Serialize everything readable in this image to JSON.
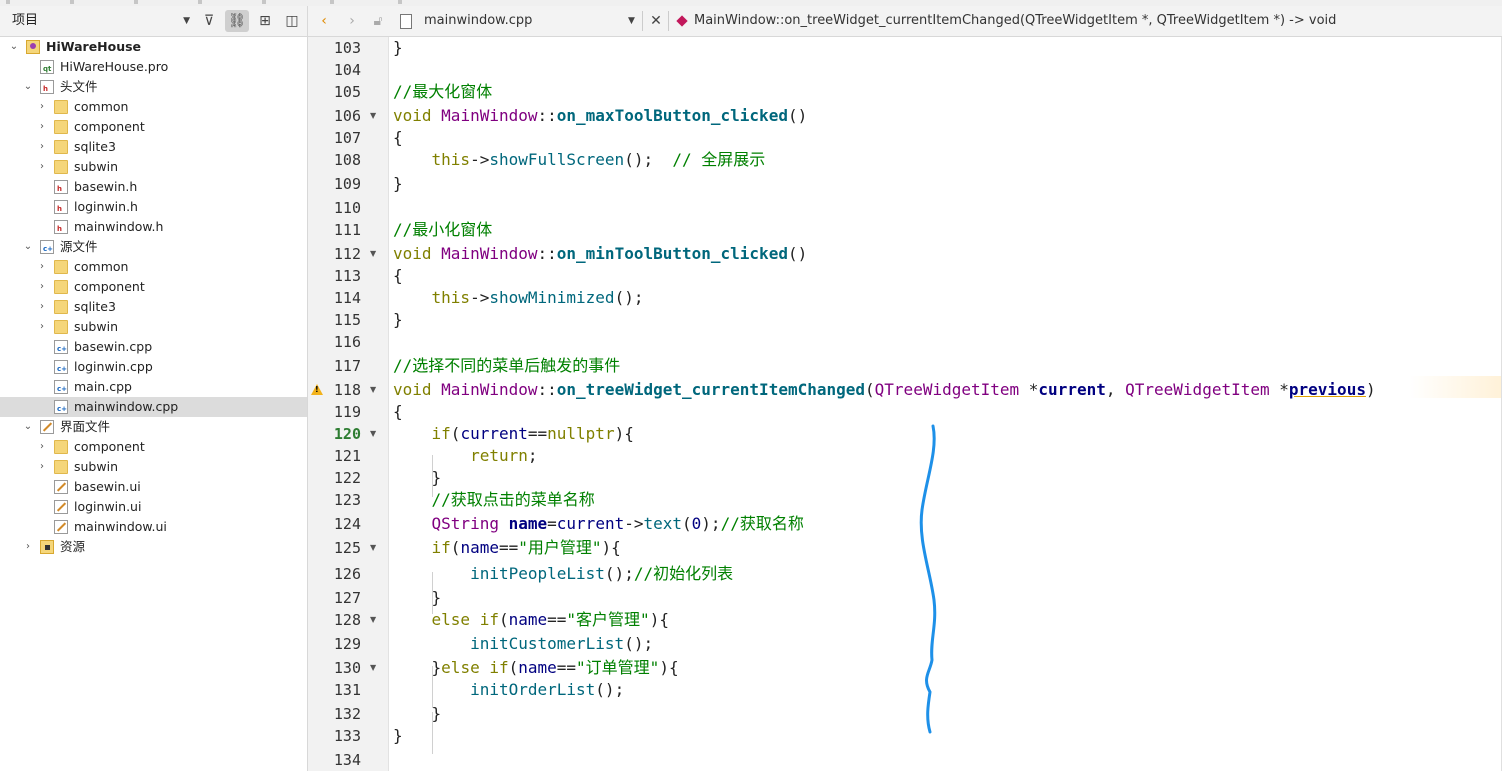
{
  "project_pane": {
    "selector_label": "项目",
    "tree": [
      {
        "label": "HiWareHouse",
        "icon": "project-icon",
        "level": 0,
        "expanded": true,
        "bold": true
      },
      {
        "label": "HiWareHouse.pro",
        "icon": "pro-file-icon",
        "level": 1
      },
      {
        "label": "头文件",
        "icon": "header-folder-icon",
        "level": 1,
        "expanded": true
      },
      {
        "label": "common",
        "icon": "folder-icon",
        "level": 2,
        "collapsed": true
      },
      {
        "label": "component",
        "icon": "folder-icon",
        "level": 2,
        "collapsed": true
      },
      {
        "label": "sqlite3",
        "icon": "folder-icon",
        "level": 2,
        "collapsed": true
      },
      {
        "label": "subwin",
        "icon": "folder-icon",
        "level": 2,
        "collapsed": true
      },
      {
        "label": "basewin.h",
        "icon": "h-file-icon",
        "level": 2
      },
      {
        "label": "loginwin.h",
        "icon": "h-file-icon",
        "level": 2
      },
      {
        "label": "mainwindow.h",
        "icon": "h-file-icon",
        "level": 2
      },
      {
        "label": "源文件",
        "icon": "source-folder-icon",
        "level": 1,
        "expanded": true
      },
      {
        "label": "common",
        "icon": "folder-icon",
        "level": 2,
        "collapsed": true
      },
      {
        "label": "component",
        "icon": "folder-icon",
        "level": 2,
        "collapsed": true
      },
      {
        "label": "sqlite3",
        "icon": "folder-icon",
        "level": 2,
        "collapsed": true
      },
      {
        "label": "subwin",
        "icon": "folder-icon",
        "level": 2,
        "collapsed": true
      },
      {
        "label": "basewin.cpp",
        "icon": "cpp-file-icon",
        "level": 2
      },
      {
        "label": "loginwin.cpp",
        "icon": "cpp-file-icon",
        "level": 2
      },
      {
        "label": "main.cpp",
        "icon": "cpp-file-icon",
        "level": 2
      },
      {
        "label": "mainwindow.cpp",
        "icon": "cpp-file-icon",
        "level": 2,
        "selected": true
      },
      {
        "label": "界面文件",
        "icon": "forms-folder-icon",
        "level": 1,
        "expanded": true
      },
      {
        "label": "component",
        "icon": "folder-icon",
        "level": 2,
        "collapsed": true
      },
      {
        "label": "subwin",
        "icon": "folder-icon",
        "level": 2,
        "collapsed": true
      },
      {
        "label": "basewin.ui",
        "icon": "ui-file-icon",
        "level": 2
      },
      {
        "label": "loginwin.ui",
        "icon": "ui-file-icon",
        "level": 2
      },
      {
        "label": "mainwindow.ui",
        "icon": "ui-file-icon",
        "level": 2
      },
      {
        "label": "资源",
        "icon": "resource-folder-icon",
        "level": 1,
        "collapsed": true
      }
    ]
  },
  "editor": {
    "filename": "mainwindow.cpp",
    "symbol": "MainWindow::on_treeWidget_currentItemChanged(QTreeWidgetItem *, QTreeWidgetItem *) -> void",
    "current_line": "120",
    "warning_line": "118",
    "colors": {
      "keyword": "#808000",
      "class": "#800080",
      "function": "#00677c",
      "comment": "#008000",
      "annotation": "#1e90e8"
    },
    "lines": [
      {
        "n": "103",
        "fold": false,
        "tokens": [
          [
            "op",
            "}"
          ]
        ]
      },
      {
        "n": "104",
        "fold": false,
        "tokens": []
      },
      {
        "n": "105",
        "fold": false,
        "tokens": [
          [
            "cm",
            "//最大化窗体"
          ]
        ]
      },
      {
        "n": "106",
        "fold": true,
        "tokens": [
          [
            "kw",
            "void "
          ],
          [
            "cls",
            "MainWindow"
          ],
          [
            "op",
            "::"
          ],
          [
            "fn",
            "on_maxToolButton_clicked"
          ],
          [
            "op",
            "()"
          ]
        ]
      },
      {
        "n": "107",
        "fold": false,
        "tokens": [
          [
            "op",
            "{"
          ]
        ]
      },
      {
        "n": "108",
        "fold": false,
        "tokens": [
          [
            "op",
            "    "
          ],
          [
            "kw",
            "this"
          ],
          [
            "op",
            "->"
          ],
          [
            "call",
            "showFullScreen"
          ],
          [
            "op",
            "();  "
          ],
          [
            "cm",
            "// 全屏展示"
          ]
        ]
      },
      {
        "n": "109",
        "fold": false,
        "tokens": [
          [
            "op",
            "}"
          ]
        ]
      },
      {
        "n": "110",
        "fold": false,
        "tokens": []
      },
      {
        "n": "111",
        "fold": false,
        "tokens": [
          [
            "cm",
            "//最小化窗体"
          ]
        ]
      },
      {
        "n": "112",
        "fold": true,
        "tokens": [
          [
            "kw",
            "void "
          ],
          [
            "cls",
            "MainWindow"
          ],
          [
            "op",
            "::"
          ],
          [
            "fn",
            "on_minToolButton_clicked"
          ],
          [
            "op",
            "()"
          ]
        ]
      },
      {
        "n": "113",
        "fold": false,
        "tokens": [
          [
            "op",
            "{"
          ]
        ]
      },
      {
        "n": "114",
        "fold": false,
        "tokens": [
          [
            "op",
            "    "
          ],
          [
            "kw",
            "this"
          ],
          [
            "op",
            "->"
          ],
          [
            "call",
            "showMinimized"
          ],
          [
            "op",
            "();"
          ]
        ]
      },
      {
        "n": "115",
        "fold": false,
        "tokens": [
          [
            "op",
            "}"
          ]
        ]
      },
      {
        "n": "116",
        "fold": false,
        "tokens": []
      },
      {
        "n": "117",
        "fold": false,
        "tokens": [
          [
            "cm",
            "//选择不同的菜单后触发的事件"
          ]
        ]
      },
      {
        "n": "118",
        "fold": true,
        "tokens": [
          [
            "kw",
            "void "
          ],
          [
            "cls",
            "MainWindow"
          ],
          [
            "op",
            "::"
          ],
          [
            "fn",
            "on_treeWidget_currentItemChanged"
          ],
          [
            "op",
            "("
          ],
          [
            "cls",
            "QTreeWidgetItem"
          ],
          [
            "op",
            " *"
          ],
          [
            "b",
            "current"
          ],
          [
            "op",
            ", "
          ],
          [
            "cls",
            "QTreeWidgetItem"
          ],
          [
            "op",
            " *"
          ],
          [
            "bu",
            "previous"
          ],
          [
            "op",
            ")"
          ]
        ]
      },
      {
        "n": "119",
        "fold": false,
        "tokens": [
          [
            "op",
            "{"
          ]
        ]
      },
      {
        "n": "120",
        "fold": true,
        "tokens": [
          [
            "op",
            "    "
          ],
          [
            "kw",
            "if"
          ],
          [
            "op",
            "("
          ],
          [
            "nm",
            "current"
          ],
          [
            "op",
            "=="
          ],
          [
            "kw",
            "nullptr"
          ],
          [
            "op",
            "){"
          ]
        ]
      },
      {
        "n": "121",
        "fold": false,
        "tokens": [
          [
            "op",
            "        "
          ],
          [
            "kw",
            "return"
          ],
          [
            "op",
            ";"
          ]
        ]
      },
      {
        "n": "122",
        "fold": false,
        "tokens": [
          [
            "op",
            "    }"
          ]
        ]
      },
      {
        "n": "123",
        "fold": false,
        "tokens": [
          [
            "op",
            "    "
          ],
          [
            "cm",
            "//获取点击的菜单名称"
          ]
        ]
      },
      {
        "n": "124",
        "fold": false,
        "tokens": [
          [
            "op",
            "    "
          ],
          [
            "cls",
            "QString"
          ],
          [
            "op",
            " "
          ],
          [
            "b",
            "name"
          ],
          [
            "op",
            "="
          ],
          [
            "nm",
            "current"
          ],
          [
            "op",
            "->"
          ],
          [
            "call",
            "text"
          ],
          [
            "op",
            "("
          ],
          [
            "numv",
            "0"
          ],
          [
            "op",
            ");"
          ],
          [
            "cm",
            "//获取名称"
          ]
        ]
      },
      {
        "n": "125",
        "fold": true,
        "tokens": [
          [
            "op",
            "    "
          ],
          [
            "kw",
            "if"
          ],
          [
            "op",
            "("
          ],
          [
            "nm",
            "name"
          ],
          [
            "op",
            "=="
          ],
          [
            "str",
            "\"用户管理\""
          ],
          [
            "op",
            "){"
          ]
        ]
      },
      {
        "n": "126",
        "fold": false,
        "tokens": [
          [
            "op",
            "        "
          ],
          [
            "call",
            "initPeopleList"
          ],
          [
            "op",
            "();"
          ],
          [
            "cm",
            "//初始化列表"
          ]
        ]
      },
      {
        "n": "127",
        "fold": false,
        "tokens": [
          [
            "op",
            "    }"
          ]
        ]
      },
      {
        "n": "128",
        "fold": true,
        "tokens": [
          [
            "op",
            "    "
          ],
          [
            "kw",
            "else if"
          ],
          [
            "op",
            "("
          ],
          [
            "nm",
            "name"
          ],
          [
            "op",
            "=="
          ],
          [
            "str",
            "\"客户管理\""
          ],
          [
            "op",
            "){"
          ]
        ]
      },
      {
        "n": "129",
        "fold": false,
        "tokens": [
          [
            "op",
            "        "
          ],
          [
            "call",
            "initCustomerList"
          ],
          [
            "op",
            "();"
          ]
        ]
      },
      {
        "n": "130",
        "fold": true,
        "tokens": [
          [
            "op",
            "    }"
          ],
          [
            "kw",
            "else if"
          ],
          [
            "op",
            "("
          ],
          [
            "nm",
            "name"
          ],
          [
            "op",
            "=="
          ],
          [
            "str",
            "\"订单管理\""
          ],
          [
            "op",
            "){"
          ]
        ]
      },
      {
        "n": "131",
        "fold": false,
        "tokens": [
          [
            "op",
            "        "
          ],
          [
            "call",
            "initOrderList"
          ],
          [
            "op",
            "();"
          ]
        ]
      },
      {
        "n": "132",
        "fold": false,
        "tokens": [
          [
            "op",
            "    }"
          ]
        ]
      },
      {
        "n": "133",
        "fold": false,
        "tokens": [
          [
            "op",
            "}"
          ]
        ]
      },
      {
        "n": "134",
        "fold": false,
        "tokens": []
      }
    ]
  }
}
